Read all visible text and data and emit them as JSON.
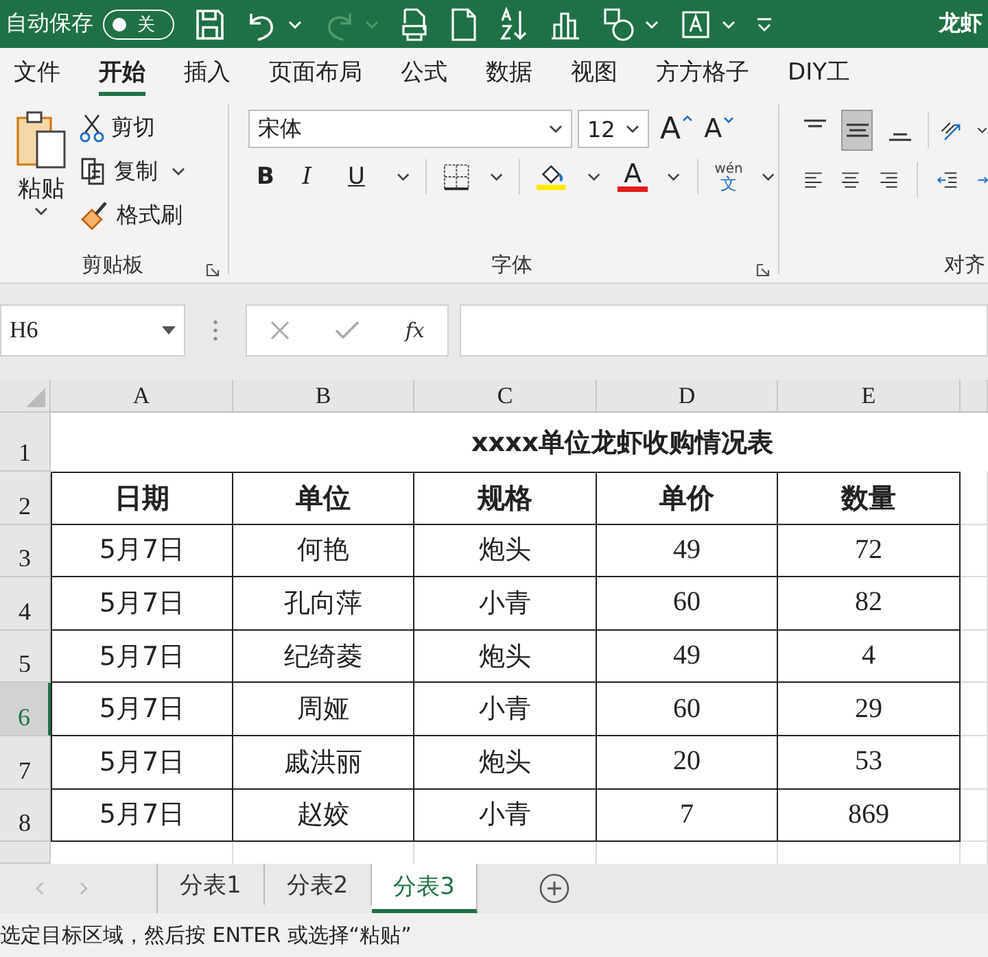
{
  "title_bar": {
    "autosave_label": "自动保存",
    "autosave": {
      "on": false,
      "state_label": "关"
    },
    "redo_enabled": false,
    "document_title": "龙虾"
  },
  "menu_tabs": [
    {
      "label": "文件",
      "selected": false
    },
    {
      "label": "开始",
      "selected": true
    },
    {
      "label": "插入",
      "selected": false
    },
    {
      "label": "页面布局",
      "selected": false
    },
    {
      "label": "公式",
      "selected": false
    },
    {
      "label": "数据",
      "selected": false
    },
    {
      "label": "视图",
      "selected": false
    },
    {
      "label": "方方格子",
      "selected": false
    },
    {
      "label": "DIY工",
      "selected": false
    }
  ],
  "clipboard": {
    "paste": "粘贴",
    "cut": "剪切",
    "copy": "复制",
    "format_painter": "格式刷",
    "group_label": "剪贴板"
  },
  "font": {
    "name": "宋体",
    "size": "12",
    "grow": "A",
    "shrink": "A",
    "bold": "B",
    "italic": "I",
    "underline": "U",
    "font_color": "A",
    "phonetic_top": "wén",
    "phonetic_bottom": "文",
    "group_label": "字体"
  },
  "alignment": {
    "vertical": [
      {
        "kind": "top",
        "selected": false
      },
      {
        "kind": "middle",
        "selected": true
      },
      {
        "kind": "bottom",
        "selected": false
      }
    ],
    "group_label": "对齐"
  },
  "formula_bar": {
    "name_box": "H6",
    "function_label": "fx"
  },
  "sheet": {
    "columns": [
      "A",
      "B",
      "C",
      "D",
      "E"
    ],
    "title": "xxxx单位龙虾收购情况表",
    "header": [
      "日期",
      "单位",
      "规格",
      "单价",
      "数量"
    ],
    "rows": [
      [
        "5月7日",
        "何艳",
        "炮头",
        "49",
        "72"
      ],
      [
        "5月7日",
        "孔向萍",
        "小青",
        "60",
        "82"
      ],
      [
        "5月7日",
        "纪绮菱",
        "炮头",
        "49",
        "4"
      ],
      [
        "5月7日",
        "周娅",
        "小青",
        "60",
        "29"
      ],
      [
        "5月7日",
        "戚洪丽",
        "炮头",
        "20",
        "53"
      ],
      [
        "5月7日",
        "赵姣",
        "小青",
        "7",
        "869"
      ]
    ]
  },
  "row_headers": [
    {
      "label": "1",
      "selected": false
    },
    {
      "label": "2",
      "selected": false
    },
    {
      "label": "3",
      "selected": false
    },
    {
      "label": "4",
      "selected": false
    },
    {
      "label": "5",
      "selected": false
    },
    {
      "label": "6",
      "selected": true
    },
    {
      "label": "7",
      "selected": false
    },
    {
      "label": "8",
      "selected": false
    }
  ],
  "sheet_tabs": [
    {
      "label": "分表1",
      "selected": false
    },
    {
      "label": "分表2",
      "selected": false
    },
    {
      "label": "分表3",
      "selected": true
    }
  ],
  "status_text": "选定目标区域，然后按 ENTER 或选择“粘贴”"
}
